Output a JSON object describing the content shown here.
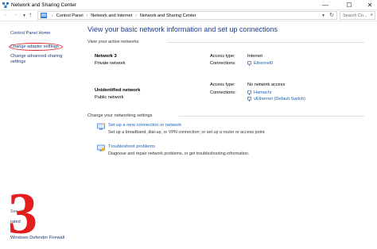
{
  "window": {
    "title": "Network and Sharing Center",
    "minimize_glyph": "—",
    "maximize_glyph": "☐",
    "close_glyph": "✕"
  },
  "address_bar": {
    "back_glyph": "←",
    "forward_glyph": "→",
    "up_glyph": "↑",
    "crumbs": [
      "Control Panel",
      "Network and Internet",
      "Network and Sharing Center"
    ],
    "search_placeholder": "Search Co..."
  },
  "left_nav": {
    "home": "Control Panel Home",
    "change_adapter": "Change adapter settings",
    "change_advanced": "Change advanced sharing settings",
    "see_also": "See also",
    "partial_item": "rated",
    "firewall": "Windows Defender Firewall"
  },
  "annotation": {
    "step_number": "3",
    "color": "#e41d1d"
  },
  "main": {
    "heading": "View your basic network information and set up connections",
    "active_networks_label": "View your active networks",
    "networks": [
      {
        "name": "Network  3",
        "type": "Private network",
        "access_type_label": "Access type:",
        "access_type": "Internet",
        "connections_label": "Connections:",
        "connections": [
          "Ethernet0"
        ]
      },
      {
        "name": "Unidentified network",
        "type": "Public network",
        "access_type_label": "Access type:",
        "access_type": "No network access",
        "connections_label": "Connections:",
        "connections": [
          "Hamachi",
          "vEthernet (Default Switch)"
        ]
      }
    ],
    "settings_label": "Change your networking settings",
    "tasks": [
      {
        "link": "Set up a new connection or network",
        "desc": "Set up a broadband, dial-up, or VPN connection; or set up a router or access point.",
        "icon": "new-connection-icon"
      },
      {
        "link": "Troubleshoot problems",
        "desc": "Diagnose and repair network problems, or get troubleshooting information.",
        "icon": "troubleshoot-icon"
      }
    ]
  },
  "colors": {
    "link": "#1a5fb4",
    "heading": "#1e3d8f",
    "highlight_circle": "#e02020"
  }
}
